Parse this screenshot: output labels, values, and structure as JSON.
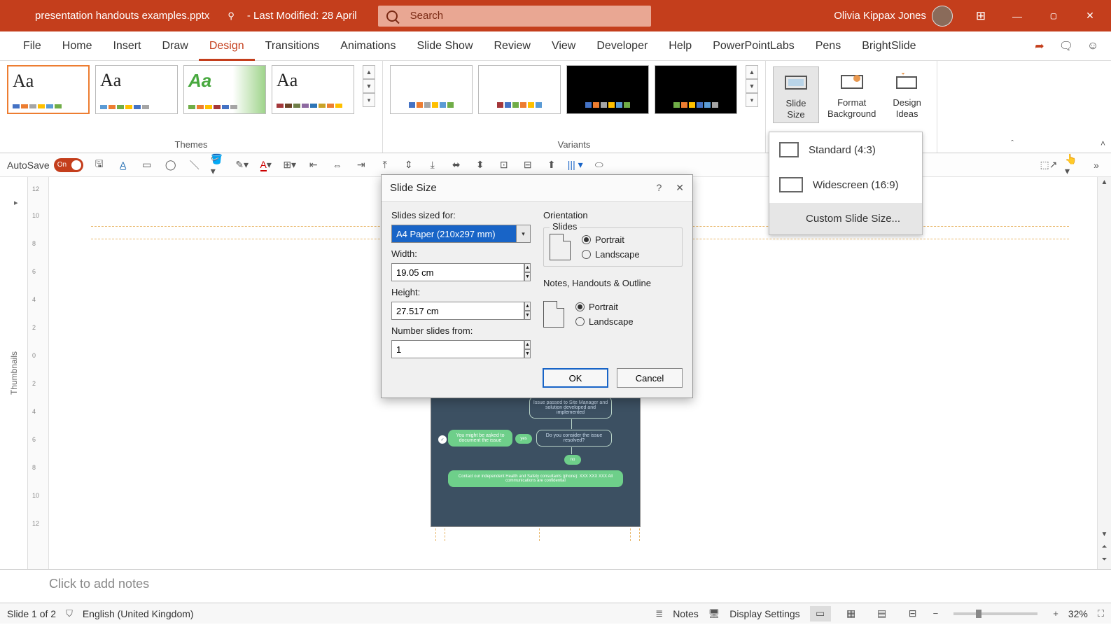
{
  "title": {
    "document": "presentation handouts examples.pptx",
    "modified": "-  Last Modified: 28 April",
    "search_placeholder": "Search",
    "user": "Olivia Kippax Jones"
  },
  "tabs": [
    "File",
    "Home",
    "Insert",
    "Draw",
    "Design",
    "Transitions",
    "Animations",
    "Slide Show",
    "Review",
    "View",
    "Developer",
    "Help",
    "PowerPointLabs",
    "Pens",
    "BrightSlide"
  ],
  "active_tab_index": 4,
  "ribbon": {
    "themes_label": "Themes",
    "variants_label": "Variants",
    "slide_size": "Slide\nSize",
    "format_bg": "Format\nBackground",
    "design_ideas": "Design\nIdeas"
  },
  "qat": {
    "autosave": "AutoSave",
    "autosave_state": "On"
  },
  "dropdown": {
    "standard": "Standard (4:3)",
    "widescreen": "Widescreen (16:9)",
    "custom": "Custom Slide Size..."
  },
  "dialog": {
    "title": "Slide Size",
    "sized_for_label": "Slides sized for:",
    "sized_for_value": "A4 Paper (210x297 mm)",
    "width_label": "Width:",
    "width_value": "19.05 cm",
    "height_label": "Height:",
    "height_value": "27.517 cm",
    "number_label": "Number slides from:",
    "number_value": "1",
    "orientation_label": "Orientation",
    "slides_group": "Slides",
    "notes_group": "Notes, Handouts & Outline",
    "portrait": "Portrait",
    "landscape": "Landscape",
    "ok": "OK",
    "cancel": "Cancel"
  },
  "thumbnails_label": "Thumbnails",
  "ruler_ticks": [
    "12",
    "10",
    "8",
    "6",
    "4",
    "2",
    "0",
    "2",
    "4",
    "6",
    "8",
    "10",
    "12"
  ],
  "notes_placeholder": "Click to add notes",
  "status": {
    "slide": "Slide 1 of 2",
    "lang": "English (United Kingdom)",
    "notes_btn": "Notes",
    "display": "Display Settings",
    "zoom": "32%"
  },
  "slide_content": {
    "box1": "Issue passed to Site Manager and solution developed and implemented",
    "box2": "You might be asked to document the issue",
    "box3": "Do you consider the issue resolved?",
    "box4": "Contact our independent Health and Safety consultants (phone): XXX XXX XXX\nAll communications are confidential",
    "yes": "yes",
    "no": "no",
    "chk": "✓"
  }
}
